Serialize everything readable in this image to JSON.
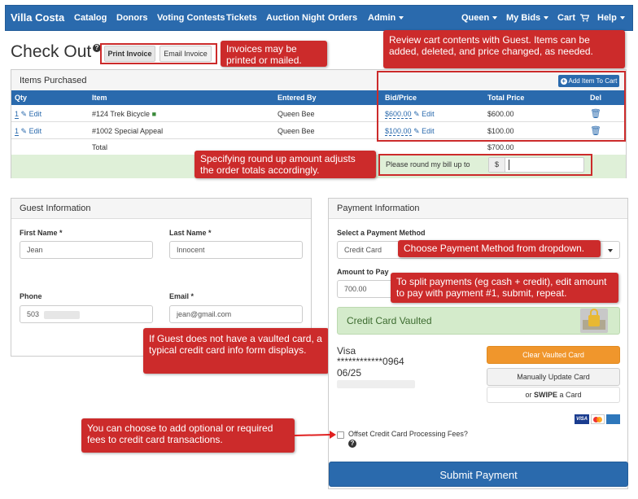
{
  "navbar": {
    "brand": "Villa Costa",
    "items": [
      "Catalog",
      "Donors",
      "Voting Contests",
      "Tickets",
      "Auction Night",
      "Orders",
      "Admin"
    ],
    "user": "Queen",
    "my_bids": "My Bids",
    "cart": "Cart",
    "help": "Help"
  },
  "header": {
    "title": "Check Out",
    "print_label": "Print Invoice",
    "email_label": "Email Invoice"
  },
  "callouts": {
    "invoices": "Invoices may be printed or mailed.",
    "review_cart": "Review cart contents with Guest. Items can be added, deleted, and price changed, as needed.",
    "round_up": "Specifying round up amount adjusts the order totals accordingly.",
    "payment_method": "Choose Payment Method from dropdown.",
    "split_payments": "To split payments (eg cash + credit), edit amount to pay with payment #1, submit, repeat.",
    "no_vaulted": "If Guest does not have a vaulted card, a typical credit card info form displays.",
    "fees": "You can choose to add optional or required fees to credit card transactions."
  },
  "items_panel": {
    "title": "Items Purchased",
    "add_item_label": "Add Item To Cart",
    "columns": [
      "Qty",
      "Item",
      "Entered By",
      "Bid/Price",
      "Total Price",
      "Del"
    ],
    "rows": [
      {
        "qty": "1",
        "edit": "Edit",
        "item": "#124 Trek Bicycle",
        "entered_by": "Queen Bee",
        "bid": "$600.00",
        "bid_edit": "Edit",
        "total": "$600.00"
      },
      {
        "qty": "1",
        "edit": "Edit",
        "item": "#1002 Special Appeal",
        "entered_by": "Queen Bee",
        "bid": "$100.00",
        "bid_edit": "Edit",
        "total": "$100.00"
      }
    ],
    "total_label": "Total",
    "total_value": "$700.00",
    "round_label": "Please round my bill up to",
    "currency_symbol": "$"
  },
  "guest": {
    "title": "Guest Information",
    "first_name_label": "First Name *",
    "first_name_value": "Jean",
    "last_name_label": "Last Name *",
    "last_name_value": "Innocent",
    "phone_label": "Phone",
    "phone_value": "503",
    "email_label": "Email *",
    "email_value": "jean@gmail.com"
  },
  "payment": {
    "title": "Payment Information",
    "method_label": "Select a Payment Method",
    "method_value": "Credit Card",
    "amount_label": "Amount to Pay",
    "amount_value": "700.00",
    "vaulted_label": "Credit Card Vaulted",
    "card_type": "Visa",
    "card_number": "************0964",
    "card_exp": "06/25",
    "clear_label": "Clear Vaulted Card",
    "update_label": "Manually Update Card",
    "swipe_or": "or",
    "swipe_label": "SWIPE",
    "swipe_suffix": "a Card",
    "offset_label": "Offset Credit Card Processing Fees?",
    "submit_label": "Submit Payment"
  },
  "colors": {
    "nav": "#2a6aad",
    "callout": "#cc2b2b",
    "clear_button": "#f0962c",
    "submit_button": "#2a6aad",
    "vaulted_bg": "#d4ebcb"
  }
}
